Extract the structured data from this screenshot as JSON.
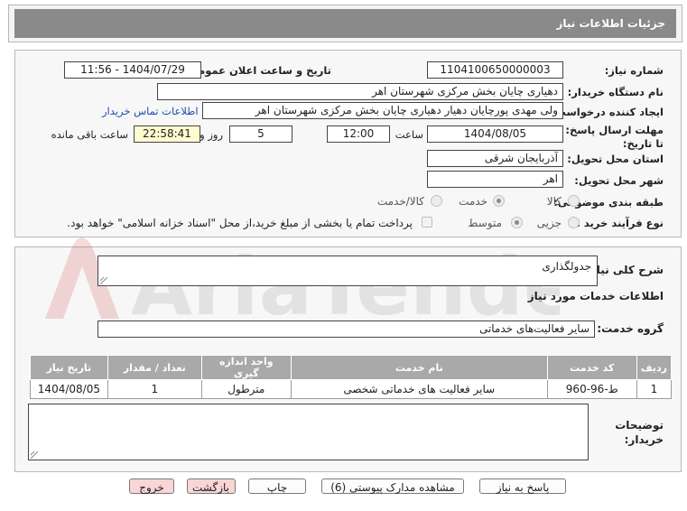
{
  "header": {
    "title": "جزئیات اطلاعات نیاز"
  },
  "form": {
    "need_number_label": "شماره نیاز:",
    "need_number": "1104100650000003",
    "announce_label": "تاریخ و ساعت اعلان عمومی:",
    "announce_value": "1404/07/29 - 11:56",
    "buyer_org_label": "نام دستگاه خریدار:",
    "buyer_org": "دهیاری چایان بخش مرکزی شهرستان اهر",
    "requester_label": "ایجاد کننده درخواست:",
    "requester": "ولی مهدی پورچایان دهیار دهیاری چایان بخش مرکزی شهرستان اهر",
    "contact_link": "اطلاعات تماس خریدار",
    "deadline_label": "مهلت ارسال پاسخ: تا تاریخ:",
    "deadline_date": "1404/08/05",
    "time_label": "ساعت",
    "deadline_time": "12:00",
    "days_value": "5",
    "days_label": "روز و",
    "remaining_time": "22:58:41",
    "remaining_label": "ساعت باقی مانده",
    "province_label": "استان محل تحویل:",
    "province": "آذربایجان شرقی",
    "city_label": "شهر محل تحویل:",
    "city": "اهر",
    "category_label": "طبقه بندی موضوعی:",
    "category_options": [
      "کالا",
      "خدمت",
      "کالا/خدمت"
    ],
    "category_selected": "خدمت",
    "process_label": "نوع فرآیند خرید :",
    "process_options": [
      "جزیی",
      "متوسط"
    ],
    "process_selected": "متوسط",
    "payment_note": "پرداخت تمام یا بخشی از مبلغ خرید،از محل \"اسناد خزانه اسلامی\" خواهد بود."
  },
  "description": {
    "label": "شرح کلی نیاز:",
    "value": "جدولگذاری"
  },
  "services": {
    "section_title": "اطلاعات خدمات مورد نیاز",
    "group_label": "گروه خدمت:",
    "group_value": "سایر فعالیت‌های خدماتی",
    "table_headers": [
      "ردیف",
      "کد خدمت",
      "نام خدمت",
      "واحد اندازه گیری",
      "تعداد / مقدار",
      "تاریخ نیاز"
    ],
    "rows": [
      [
        "1",
        "ط-96-960",
        "سایر فعالیت های خدماتی شخصی",
        "مترطول",
        "1",
        "1404/08/05"
      ]
    ]
  },
  "buyer_notes": {
    "label": "توضیحات خریدار:",
    "value": ""
  },
  "buttons": {
    "reply": "پاسخ به نیاز",
    "attachments": "مشاهده مدارک پیوستی (6)",
    "print": "چاپ",
    "back": "بازگشت",
    "exit": "خروج"
  },
  "watermark": {
    "text": "AriaTender.net"
  },
  "colors": {
    "header_bg": "#8a8a8a",
    "table_header_bg": "#a9a9a9",
    "highlight_box": "#fefccf",
    "link": "#1f4ea8",
    "danger_button": "#f9d5d5"
  }
}
